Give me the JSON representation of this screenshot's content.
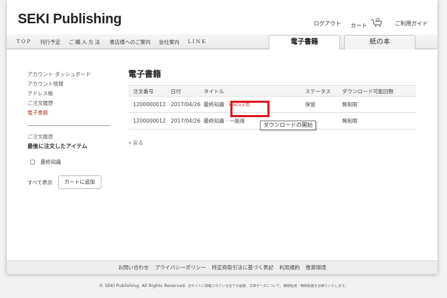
{
  "header": {
    "logo": "SEKI Publishing",
    "logout": "ログアウト",
    "cart": "カート",
    "guide": "ご利用ガイド"
  },
  "nav": {
    "items": [
      "TOP",
      "刊行予定",
      "ご購入方法",
      "書店様へのご案内",
      "会社案内",
      "LINK"
    ],
    "tabs": {
      "ebook": "電子書籍",
      "paper": "紙の本"
    }
  },
  "sidebar": {
    "items": [
      "アカウント ダッシュボード",
      "アカウント情報",
      "アドレス帳",
      "ご注文履歴",
      "電子書籍"
    ],
    "active": "電子書籍",
    "recent_label": "ご注文履歴",
    "recent_heading": "最後に注文したアイテム",
    "recent_item": "最終知識",
    "show_all": "すべて表示",
    "add_to_cart": "カートに追加"
  },
  "main": {
    "title": "電子書籍",
    "columns": [
      "注文番号",
      "日付",
      "タイトル",
      "ステータス",
      "ダウンロード可能回数"
    ],
    "rows": [
      {
        "order": "1200000012",
        "date": "2017/04/26",
        "title": "最終知識",
        "link": "- KINDLE用",
        "status": "保留",
        "downloads": "無制限"
      },
      {
        "order": "1200000012",
        "date": "2017/04/26",
        "title": "最終知識 - 一般用",
        "link": "",
        "status": "",
        "downloads": "無制限"
      }
    ],
    "tooltip": "ダウンロードの開始",
    "back": "« 戻る"
  },
  "footer": {
    "links": [
      "お問い合わせ",
      "プライバシーポリシー",
      "特定商取引法に基づく表記",
      "利用規約",
      "推奨環境"
    ],
    "copyright": "© SEKI Publishing. All Rights Reserved.",
    "note": "当サイトに掲載されている全ての画像、文章データについて、無断転用・無断転載をお断りいたします。"
  },
  "colors": {
    "accent": "#c0504d",
    "highlight": "#e0101a"
  }
}
